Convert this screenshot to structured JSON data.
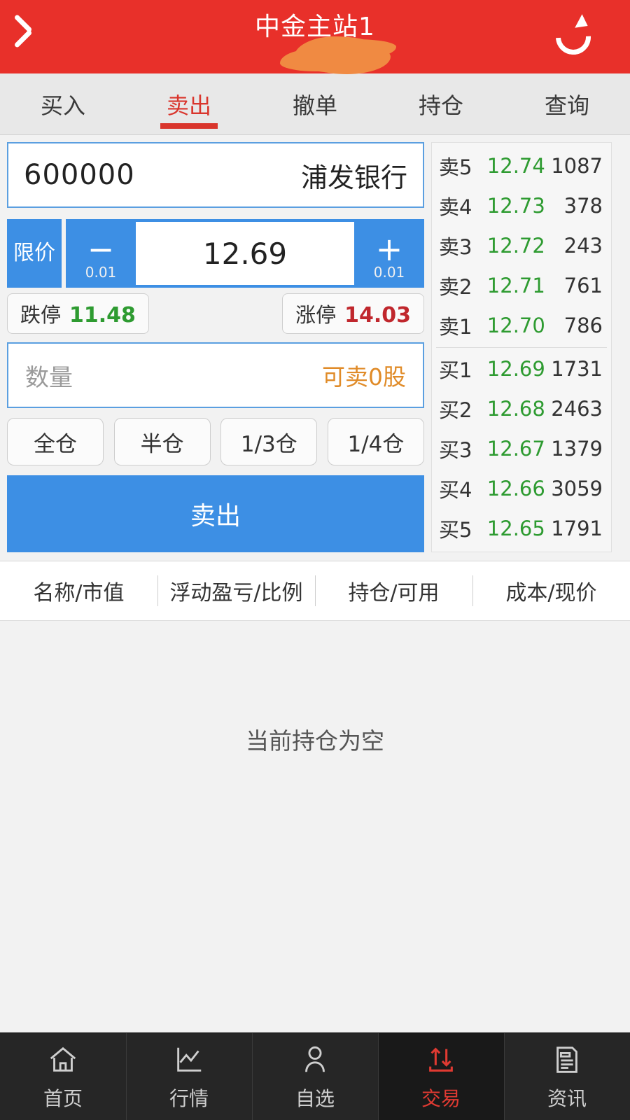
{
  "header": {
    "title": "中金主站1",
    "subtitle": "**",
    "back_icon": "back-chevron-icon",
    "refresh_icon": "refresh-icon",
    "bg_color": "#e8302a"
  },
  "tabs": {
    "items": [
      {
        "label": "买入",
        "active": false
      },
      {
        "label": "卖出",
        "active": true
      },
      {
        "label": "撤单",
        "active": false
      },
      {
        "label": "持仓",
        "active": false
      },
      {
        "label": "查询",
        "active": false
      }
    ],
    "active_color": "#d9352c"
  },
  "order_form": {
    "stock_code": "600000",
    "stock_name": "浦发银行",
    "price_type": "限价",
    "price_value": "12.69",
    "decrement_glyph": "−",
    "decrement_step": "0.01",
    "increment_glyph": "+",
    "increment_step": "0.01",
    "limit_down_label": "跌停",
    "limit_down_value": "11.48",
    "limit_up_label": "涨停",
    "limit_up_value": "14.03",
    "quantity_placeholder": "数量",
    "quantity_value": "",
    "available_text": "可卖0股",
    "presets": [
      "全仓",
      "半仓",
      "1/3仓",
      "1/4仓"
    ],
    "submit_label": "卖出",
    "submit_color": "#3d8fe4",
    "down_color": "#2e9b31",
    "up_color": "#c0272d",
    "avail_color": "#e08b28"
  },
  "order_book": {
    "asks": [
      {
        "label": "卖5",
        "price": "12.74",
        "volume": "1087"
      },
      {
        "label": "卖4",
        "price": "12.73",
        "volume": "378"
      },
      {
        "label": "卖3",
        "price": "12.72",
        "volume": "243"
      },
      {
        "label": "卖2",
        "price": "12.71",
        "volume": "761"
      },
      {
        "label": "卖1",
        "price": "12.70",
        "volume": "786"
      }
    ],
    "bids": [
      {
        "label": "买1",
        "price": "12.69",
        "volume": "1731"
      },
      {
        "label": "买2",
        "price": "12.68",
        "volume": "2463"
      },
      {
        "label": "买3",
        "price": "12.67",
        "volume": "1379"
      },
      {
        "label": "买4",
        "price": "12.66",
        "volume": "3059"
      },
      {
        "label": "买5",
        "price": "12.65",
        "volume": "1791"
      }
    ],
    "price_color": "#2e9b31"
  },
  "position_table": {
    "columns": [
      "名称/市值",
      "浮动盈亏/比例",
      "持仓/可用",
      "成本/现价"
    ],
    "empty_text": "当前持仓为空"
  },
  "bottom_nav": {
    "items": [
      {
        "label": "首页",
        "icon": "home-icon",
        "active": false
      },
      {
        "label": "行情",
        "icon": "chart-icon",
        "active": false
      },
      {
        "label": "自选",
        "icon": "person-icon",
        "active": false
      },
      {
        "label": "交易",
        "icon": "transfer-icon",
        "active": true
      },
      {
        "label": "资讯",
        "icon": "news-icon",
        "active": false
      }
    ],
    "active_color": "#e03a32"
  }
}
